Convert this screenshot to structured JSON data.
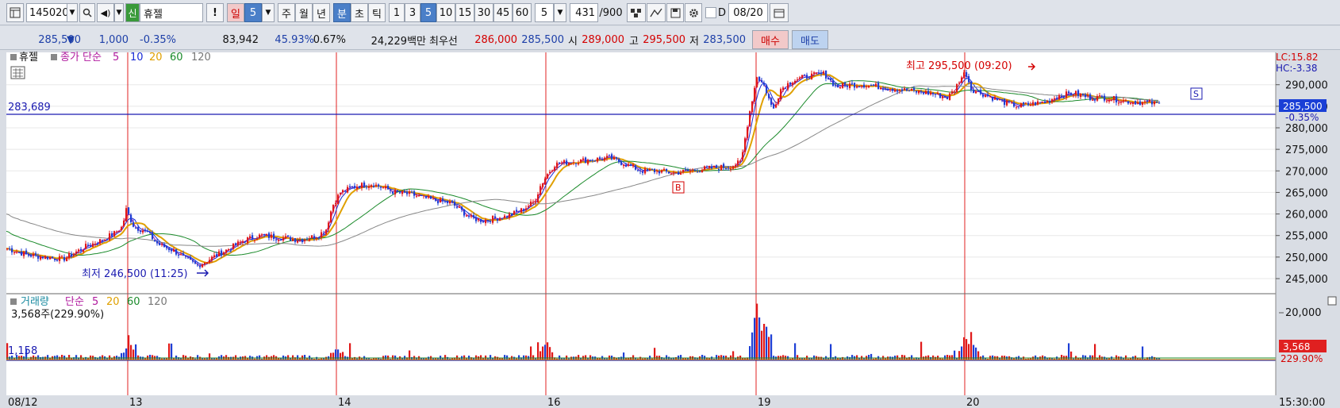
{
  "toolbar": {
    "stock_code": "145020",
    "badge": "신",
    "stock_name": "휴젤",
    "alert": "!",
    "period_day": "일",
    "period_val": "5",
    "week": "주",
    "month": "월",
    "year": "년",
    "minute": "분",
    "second": "초",
    "tick": "틱",
    "min_options": [
      "1",
      "3",
      "5",
      "10",
      "15",
      "30",
      "45",
      "60"
    ],
    "count": "5",
    "range_current": "431",
    "range_total": "/900",
    "d_label": "D",
    "date": "08/20"
  },
  "quote": {
    "price": "285,500",
    "arrow": "▼",
    "change": "1,000",
    "change_pct": "-0.35%",
    "volume": "83,942",
    "vol_ratio": "45.93%",
    "turnover": "0.67%",
    "amount": "24,229백만",
    "bid_label": "최우선",
    "ask": "286,000",
    "bid": "285,500",
    "open_label": "시",
    "open": "289,000",
    "high_label": "고",
    "high": "295,500",
    "low_label": "저",
    "low": "283,500",
    "buy_btn": "매수",
    "sell_btn": "매도"
  },
  "chart_data": {
    "type": "candlestick",
    "price_panel": {
      "legend_name": "휴젤",
      "legend_ma": "종가 단순",
      "ma_periods": [
        "5",
        "10",
        "20",
        "60",
        "120"
      ],
      "y_ticks": [
        245000,
        250000,
        255000,
        260000,
        265000,
        270000,
        275000,
        280000,
        285000,
        290000
      ],
      "y_tick_labels": [
        "245,000",
        "250,000",
        "255,000",
        "260,000",
        "265,000",
        "270,000",
        "275,000",
        "280,000",
        "285,000",
        "290,000"
      ],
      "ylim": [
        241500,
        297500
      ],
      "ref_line_value": 283689,
      "ref_line_label": "283,689",
      "current_price_label": "285,500",
      "current_change_label": "-0.35%",
      "lc_label": "LC:15.82",
      "hc_label": "HC:-3.38",
      "high_annotation": "최고 295,500 (09:20)",
      "low_annotation": "최저 246,500 (11:25)",
      "signal_b": "B",
      "signal_s": "S",
      "close_keypoints": [
        [
          0,
          252000
        ],
        [
          25,
          250500
        ],
        [
          50,
          250000
        ],
        [
          70,
          249500
        ],
        [
          100,
          252500
        ],
        [
          120,
          254000
        ],
        [
          135,
          255500
        ],
        [
          145,
          257000
        ],
        [
          150,
          261000
        ],
        [
          160,
          257000
        ],
        [
          175,
          256000
        ],
        [
          190,
          253000
        ],
        [
          210,
          251500
        ],
        [
          225,
          249500
        ],
        [
          240,
          248000
        ],
        [
          260,
          250000
        ],
        [
          280,
          252000
        ],
        [
          300,
          254000
        ],
        [
          320,
          255000
        ],
        [
          345,
          254500
        ],
        [
          370,
          254000
        ],
        [
          392,
          255000
        ],
        [
          402,
          256500
        ],
        [
          410,
          262000
        ],
        [
          420,
          265000
        ],
        [
          440,
          266500
        ],
        [
          460,
          267000
        ],
        [
          475,
          266000
        ],
        [
          490,
          265000
        ],
        [
          510,
          264500
        ],
        [
          530,
          263500
        ],
        [
          560,
          262500
        ],
        [
          585,
          259000
        ],
        [
          600,
          258500
        ],
        [
          615,
          259000
        ],
        [
          630,
          259500
        ],
        [
          650,
          261000
        ],
        [
          665,
          263000
        ],
        [
          672,
          266500
        ],
        [
          680,
          269000
        ],
        [
          690,
          271500
        ],
        [
          705,
          272000
        ],
        [
          730,
          272500
        ],
        [
          760,
          273000
        ],
        [
          780,
          271500
        ],
        [
          800,
          270000
        ],
        [
          820,
          270000
        ],
        [
          840,
          269500
        ],
        [
          860,
          270000
        ],
        [
          880,
          270500
        ],
        [
          910,
          271000
        ],
        [
          925,
          272000
        ],
        [
          935,
          283000
        ],
        [
          945,
          292000
        ],
        [
          955,
          289500
        ],
        [
          965,
          284000
        ],
        [
          975,
          289000
        ],
        [
          990,
          291000
        ],
        [
          1010,
          292000
        ],
        [
          1030,
          292500
        ],
        [
          1045,
          289500
        ],
        [
          1060,
          290000
        ],
        [
          1080,
          290000
        ],
        [
          1100,
          289500
        ],
        [
          1120,
          289000
        ],
        [
          1140,
          288500
        ],
        [
          1165,
          288000
        ],
        [
          1185,
          287000
        ],
        [
          1195,
          289000
        ],
        [
          1200,
          291000
        ],
        [
          1208,
          293000
        ],
        [
          1215,
          289000
        ],
        [
          1235,
          287500
        ],
        [
          1255,
          286000
        ],
        [
          1275,
          285000
        ],
        [
          1290,
          285500
        ],
        [
          1310,
          286000
        ],
        [
          1325,
          287500
        ],
        [
          1345,
          288000
        ],
        [
          1365,
          287000
        ],
        [
          1385,
          287000
        ],
        [
          1400,
          286500
        ],
        [
          1420,
          286000
        ],
        [
          1440,
          285800
        ],
        [
          1453,
          285500
        ]
      ]
    },
    "volume_panel": {
      "legend_name": "거래량",
      "legend_ma": "단순",
      "ma_periods": [
        "5",
        "20",
        "60",
        "120"
      ],
      "info": "3,568주(229.90%)",
      "y_tick_labels": [
        "20,000"
      ],
      "ref_label": "1,158",
      "current_label": "3,568",
      "current_pct": "229.90%"
    },
    "x_labels": [
      "08/12",
      "13",
      "14",
      "16",
      "19",
      "20"
    ],
    "time_label": "15:30:00"
  }
}
